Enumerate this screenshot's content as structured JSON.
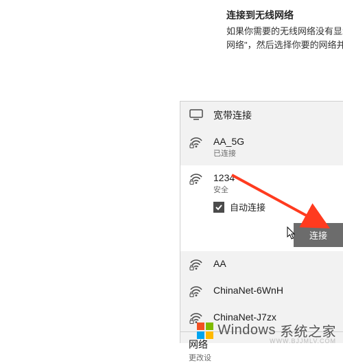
{
  "settings": {
    "title": "连接到无线网络",
    "body": "如果你需要的无线网络没有显示，选择\"显示可用网络\"，然后选择你要的网络并选择\"连接\"。"
  },
  "flyout": {
    "broadband": {
      "label": "宽带连接"
    },
    "networks": [
      {
        "name": "AA_5G",
        "sub": "已连接",
        "secured": true
      },
      {
        "name": "1234",
        "sub": "安全",
        "secured": true,
        "selected": true
      },
      {
        "name": "AA",
        "secured": true
      },
      {
        "name": "ChinaNet-6WnH",
        "secured": true
      },
      {
        "name": "ChinaNet-J7zx",
        "secured": true
      }
    ],
    "auto_connect_label": "自动连接",
    "auto_connect_checked": true,
    "connect_button": "连接",
    "footer": {
      "title": "网络",
      "sub": "更改设"
    }
  },
  "watermark": {
    "brand": "Windows",
    "tagline": "系统之家",
    "url": "WWW.BJJMLV.COM"
  }
}
